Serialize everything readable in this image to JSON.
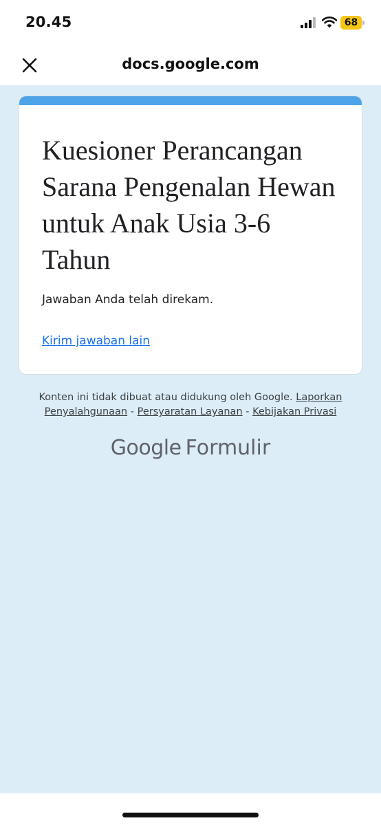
{
  "status_bar": {
    "time": "20.45",
    "battery": "68",
    "icons": [
      "signal-icon",
      "wifi-icon",
      "battery-icon"
    ]
  },
  "browser": {
    "close_icon": "close-icon",
    "domain": "docs.google.com"
  },
  "form": {
    "title": "Kuesioner Perancangan Sarana Pengenalan Hewan untuk Anak Usia 3-6 Tahun",
    "confirmation": "Jawaban Anda telah direkam.",
    "resubmit_link": "Kirim jawaban lain"
  },
  "footer": {
    "disclaimer": "Konten ini tidak dibuat atau didukung oleh Google.",
    "report_abuse": "Laporkan Penyalahgunaan",
    "separator": "-",
    "terms": "Persyaratan Layanan",
    "privacy": "Kebijakan Privasi",
    "logo_brand": "Google",
    "logo_product": "Formulir"
  },
  "colors": {
    "page_background": "#dcedf8",
    "card_accent": "#4fa3e8",
    "link": "#1a73e8",
    "battery": "#f5c518"
  }
}
